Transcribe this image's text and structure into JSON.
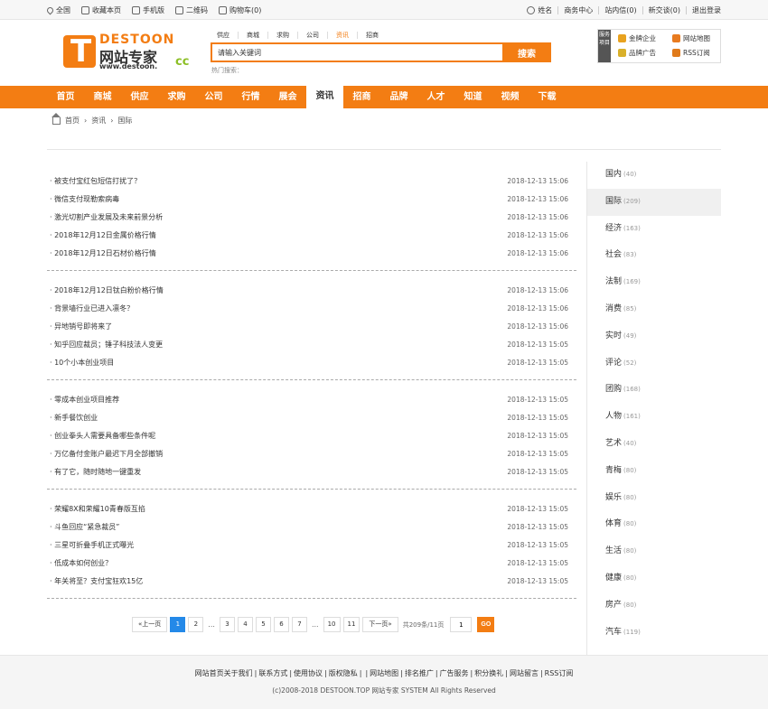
{
  "topbar": {
    "left": [
      "全国",
      "收藏本页",
      "手机版",
      "二维码",
      "购物车(0)"
    ],
    "right": [
      "姓名",
      "商务中心",
      "站内信(0)",
      "新交谈(0)",
      "退出登录"
    ]
  },
  "logo": {
    "line1": "DESTOON",
    "line2": "网站专家",
    "line3": "www.destoon.",
    "cc": "cc"
  },
  "search": {
    "tabs": [
      "供应",
      "商城",
      "求购",
      "公司",
      "资讯",
      "招商"
    ],
    "active_tab": "资讯",
    "placeholder": "请输入关键词",
    "button": "搜索",
    "hot_label": "热门搜索："
  },
  "service": {
    "tag": "服务项目",
    "items": [
      "金牌企业",
      "网站地图",
      "品牌广告",
      "RSS订阅"
    ]
  },
  "nav": {
    "items": [
      "首页",
      "商城",
      "供应",
      "求购",
      "公司",
      "行情",
      "展会",
      "资讯",
      "招商",
      "品牌",
      "人才",
      "知道",
      "视频",
      "下载"
    ],
    "active": "资讯"
  },
  "breadcrumb": [
    "首页",
    "资讯",
    "国际"
  ],
  "articles": [
    [
      {
        "title": "被支付宝红包短信打扰了？",
        "date": "2018-12-13 15:06"
      },
      {
        "title": "微信支付现勒索病毒",
        "date": "2018-12-13 15:06"
      },
      {
        "title": "激光切割产业发展及未来前景分析",
        "date": "2018-12-13 15:06"
      },
      {
        "title": "2018年12月12日金属价格行情",
        "date": "2018-12-13 15:06"
      },
      {
        "title": "2018年12月12日石材价格行情",
        "date": "2018-12-13 15:06"
      }
    ],
    [
      {
        "title": "2018年12月12日钛白粉价格行情",
        "date": "2018-12-13 15:06"
      },
      {
        "title": "背景墙行业已进入凛冬？",
        "date": "2018-12-13 15:06"
      },
      {
        "title": "异地销号即将来了",
        "date": "2018-12-13 15:06"
      },
      {
        "title": "知乎回应裁员；锤子科技法人变更",
        "date": "2018-12-13 15:05"
      },
      {
        "title": "10个小本创业项目",
        "date": "2018-12-13 15:05"
      }
    ],
    [
      {
        "title": "零成本创业项目推荐",
        "date": "2018-12-13 15:05"
      },
      {
        "title": "新手餐饮创业",
        "date": "2018-12-13 15:05"
      },
      {
        "title": "创业拳头人需要具备哪些条件呢",
        "date": "2018-12-13 15:05"
      },
      {
        "title": "万亿备付金账户最迟下月全部撤销",
        "date": "2018-12-13 15:05"
      },
      {
        "title": "有了它，随时随地一键重发",
        "date": "2018-12-13 15:05"
      }
    ],
    [
      {
        "title": "荣耀8X和荣耀10青春版互掐",
        "date": "2018-12-13 15:05"
      },
      {
        "title": "斗鱼回应“紧急裁员”",
        "date": "2018-12-13 15:05"
      },
      {
        "title": "三星可折叠手机正式曝光",
        "date": "2018-12-13 15:05"
      },
      {
        "title": "低成本如何创业？",
        "date": "2018-12-13 15:05"
      },
      {
        "title": "年关将至？支付宝狂欢15亿",
        "date": "2018-12-13 15:05"
      }
    ]
  ],
  "pager": {
    "prev": "«上一页",
    "pages": [
      "1",
      "2",
      "...",
      "3",
      "4",
      "5",
      "6",
      "7",
      "...",
      "10",
      "11"
    ],
    "current": "1",
    "next": "下一页»",
    "info": "共209条/11页",
    "input_value": "1",
    "go": "GO"
  },
  "categories": [
    {
      "name": "国内",
      "count": "(40)"
    },
    {
      "name": "国际",
      "count": "(209)",
      "active": true
    },
    {
      "name": "经济",
      "count": "(163)"
    },
    {
      "name": "社会",
      "count": "(83)"
    },
    {
      "name": "法制",
      "count": "(169)"
    },
    {
      "name": "消费",
      "count": "(85)"
    },
    {
      "name": "实时",
      "count": "(49)"
    },
    {
      "name": "评论",
      "count": "(52)"
    },
    {
      "name": "团购",
      "count": "(168)"
    },
    {
      "name": "人物",
      "count": "(161)"
    },
    {
      "name": "艺术",
      "count": "(40)"
    },
    {
      "name": "青梅",
      "count": "(80)"
    },
    {
      "name": "娱乐",
      "count": "(80)"
    },
    {
      "name": "体育",
      "count": "(80)"
    },
    {
      "name": "生活",
      "count": "(80)"
    },
    {
      "name": "健康",
      "count": "(80)"
    },
    {
      "name": "房产",
      "count": "(80)"
    },
    {
      "name": "汽车",
      "count": "(119)"
    }
  ],
  "footer": {
    "links": [
      "网站首页",
      "关于我们",
      "|",
      "联系方式",
      "|",
      "使用协议",
      "|",
      "版权隐私",
      "|",
      "|",
      "网站地图",
      "|",
      "排名推广",
      "|",
      "广告服务",
      "|",
      "积分换礼",
      "|",
      "网站留言",
      "|",
      "RSS订阅"
    ],
    "copyright": "(c)2008-2018 DESTOON.TOP 网站专家 SYSTEM All Rights Reserved"
  },
  "colors": {
    "accent": "#f37d13",
    "current_page": "#2489e8"
  }
}
